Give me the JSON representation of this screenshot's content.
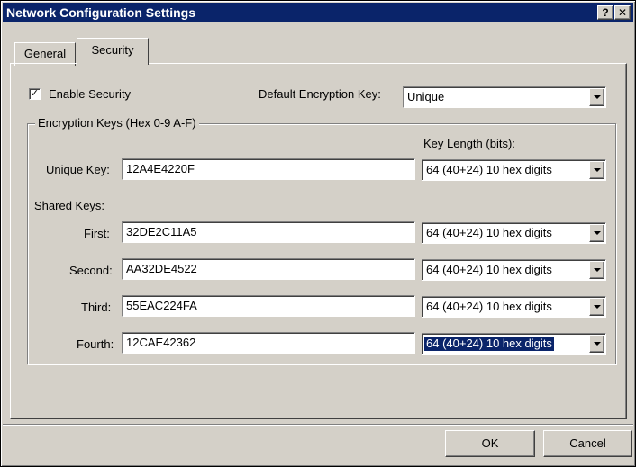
{
  "window": {
    "title": "Network Configuration Settings",
    "help_label": "?",
    "close_label": "✕"
  },
  "tabs": [
    {
      "label": "General",
      "selected": false
    },
    {
      "label": "Security",
      "selected": true
    }
  ],
  "security": {
    "enable_label": "Enable Security",
    "enable_checked": true,
    "check_glyph": "✓",
    "default_key_label": "Default Encryption Key:",
    "default_key_value": "Unique"
  },
  "keys_group": {
    "legend": "Encryption Keys (Hex 0-9 A-F)",
    "key_length_header": "Key Length (bits):",
    "shared_keys_label": "Shared Keys:",
    "rows": [
      {
        "label": "Unique Key:",
        "value": "12A4E4220F",
        "length": "64  (40+24)  10 hex digits"
      },
      {
        "label": "First:",
        "value": "32DE2C11A5",
        "length": "64  (40+24)  10 hex digits"
      },
      {
        "label": "Second:",
        "value": "AA32DE4522",
        "length": "64  (40+24)  10 hex digits"
      },
      {
        "label": "Third:",
        "value": "55EAC224FA",
        "length": "64  (40+24)  10 hex digits"
      },
      {
        "label": "Fourth:",
        "value": "12CAE42362",
        "length": "64  (40+24)  10 hex digits"
      }
    ]
  },
  "buttons": {
    "ok": "OK",
    "cancel": "Cancel"
  }
}
